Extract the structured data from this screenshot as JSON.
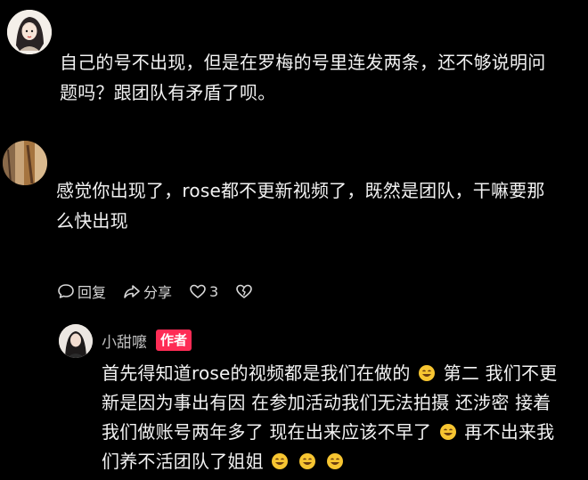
{
  "comment1": {
    "text_line1": "自己的号不出现，但是在罗梅的号里连发两条，还不够说明问",
    "text_line2": "题吗？跟团队有矛盾了呗。"
  },
  "comment2": {
    "text_line1": "感觉你出现了，rose都不更新视频了，既然是团队，干嘛要那",
    "text_line2": "么快出现",
    "actions": {
      "reply_label": "回复",
      "share_label": "分享",
      "like_count": "3"
    }
  },
  "reply": {
    "author_name": "小甜嚒",
    "badge_label": "作者",
    "line1_a": "首先得知道rose的视频都是我们在做的",
    "line1_b": "第二 我们不更",
    "line2": "新是因为事出有因 在参加活动我们无法拍摄 还涉密 接着",
    "line3_a": "我们做账号两年多了 现在出来应该不早了",
    "line3_b": "再不出来我",
    "line4": "们养不活团队了姐姐"
  },
  "colors": {
    "background": "#000000",
    "text": "#f2f2f2",
    "secondary_text": "#bdbdbd",
    "badge": "#fe2c55",
    "emoji": "#f7c531"
  }
}
